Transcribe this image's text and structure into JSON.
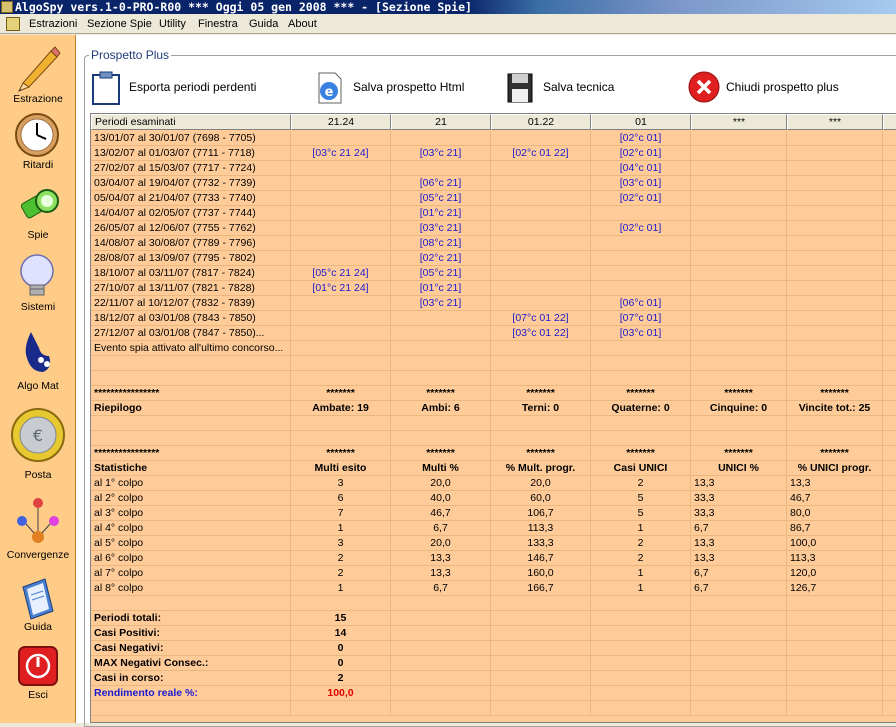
{
  "window": {
    "title": "AlgoSpy vers.1-0-PRO-R00  ***  Oggi 05 gen 2008  ***   - [Sezione Spie]"
  },
  "menu": [
    "Estrazioni",
    "Sezione Spie",
    "Utility",
    "Finestra",
    "Guida",
    "About"
  ],
  "sidebar": [
    {
      "label": "Estrazione",
      "icon": "pencil-icon"
    },
    {
      "label": "Ritardi",
      "icon": "clock-icon"
    },
    {
      "label": "Spie",
      "icon": "flashlight-icon"
    },
    {
      "label": "Sistemi",
      "icon": "lightbulb-icon"
    },
    {
      "label": "Algo Mat",
      "icon": "lottery-hand-icon"
    },
    {
      "label": "Posta",
      "icon": "euro-coin-icon"
    },
    {
      "label": "Convergenze",
      "icon": "convergence-icon"
    },
    {
      "label": "Guida",
      "icon": "book-icon"
    },
    {
      "label": "Esci",
      "icon": "exit-icon"
    }
  ],
  "group_title": "Prospetto Plus",
  "toolbar": {
    "export_label": "Esporta periodi perdenti",
    "save_html_label": "Salva prospetto Html",
    "save_tech_label": "Salva tecnica",
    "close_label": "Chiudi prospetto plus"
  },
  "colors": {
    "grid_bg": "#ffcc99",
    "sidebar_bg": "#ffcc88",
    "link_blue": "#1a1ad0",
    "accent_red": "#e00000"
  },
  "grid": {
    "headers": [
      "Periodi esaminati",
      "21.24",
      "21",
      "01.22",
      "01",
      "***",
      "***",
      ""
    ],
    "rows": [
      {
        "style": "normal",
        "cells": [
          "13/01/07 al 30/01/07  (7698 - 7705)",
          "",
          "",
          "",
          "[02°c 01]",
          "",
          "",
          ""
        ]
      },
      {
        "style": "normal",
        "cells": [
          "13/02/07 al 01/03/07  (7711 - 7718)",
          "[03°c 21 24]",
          "[03°c 21]",
          "[02°c 01 22]",
          "[02°c 01]",
          "",
          "",
          ""
        ]
      },
      {
        "style": "normal",
        "cells": [
          "27/02/07 al 15/03/07  (7717 - 7724)",
          "",
          "",
          "",
          "[04°c 01]",
          "",
          "",
          ""
        ]
      },
      {
        "style": "normal",
        "cells": [
          "03/04/07 al 19/04/07  (7732 - 7739)",
          "",
          "[06°c 21]",
          "",
          "[03°c 01]",
          "",
          "",
          ""
        ]
      },
      {
        "style": "normal",
        "cells": [
          "05/04/07 al 21/04/07  (7733 - 7740)",
          "",
          "[05°c 21]",
          "",
          "[02°c 01]",
          "",
          "",
          ""
        ]
      },
      {
        "style": "normal",
        "cells": [
          "14/04/07 al 02/05/07  (7737 - 7744)",
          "",
          "[01°c 21]",
          "",
          "",
          "",
          "",
          ""
        ]
      },
      {
        "style": "normal",
        "cells": [
          "26/05/07 al 12/06/07  (7755 - 7762)",
          "",
          "[03°c 21]",
          "",
          "[02°c 01]",
          "",
          "",
          ""
        ]
      },
      {
        "style": "normal",
        "cells": [
          "14/08/07 al 30/08/07  (7789 - 7796)",
          "",
          "[08°c 21]",
          "",
          "",
          "",
          "",
          ""
        ]
      },
      {
        "style": "normal",
        "cells": [
          "28/08/07 al 13/09/07  (7795 - 7802)",
          "",
          "[02°c 21]",
          "",
          "",
          "",
          "",
          ""
        ]
      },
      {
        "style": "normal",
        "cells": [
          "18/10/07 al 03/11/07  (7817 - 7824)",
          "[05°c 21 24]",
          "[05°c 21]",
          "",
          "",
          "",
          "",
          ""
        ]
      },
      {
        "style": "normal",
        "cells": [
          "27/10/07 al 13/11/07  (7821 - 7828)",
          "[01°c 21 24]",
          "[01°c 21]",
          "",
          "",
          "",
          "",
          ""
        ]
      },
      {
        "style": "normal",
        "cells": [
          "22/11/07 al 10/12/07  (7832 - 7839)",
          "",
          "[03°c 21]",
          "",
          "[06°c 01]",
          "",
          "",
          ""
        ]
      },
      {
        "style": "normal",
        "cells": [
          "18/12/07 al 03/01/08  (7843 - 7850)",
          "",
          "",
          "[07°c 01 22]",
          "[07°c 01]",
          "",
          "",
          ""
        ]
      },
      {
        "style": "normal",
        "cells": [
          "27/12/07 al 03/01/08  (7847 - 7850)...",
          "",
          "",
          "[03°c 01 22]",
          "[03°c 01]",
          "",
          "",
          ""
        ]
      },
      {
        "style": "normal",
        "cells": [
          "Evento spia attivato all'ultimo concorso...",
          "",
          "",
          "",
          "",
          "",
          "",
          ""
        ]
      },
      {
        "style": "normal",
        "cells": [
          "",
          "",
          "",
          "",
          "",
          "",
          "",
          ""
        ]
      },
      {
        "style": "normal",
        "cells": [
          "",
          "",
          "",
          "",
          "",
          "",
          "",
          ""
        ]
      },
      {
        "style": "stars",
        "cells": [
          "****************",
          "*******",
          "*******",
          "*******",
          "*******",
          "*******",
          "*******",
          ""
        ]
      },
      {
        "style": "bold",
        "cells": [
          "Riepilogo",
          "Ambate: 19",
          "Ambi: 6",
          "Terni: 0",
          "Quaterne: 0",
          "Cinquine: 0",
          "Vincite tot.: 25",
          ""
        ]
      },
      {
        "style": "normal",
        "cells": [
          "",
          "",
          "",
          "",
          "",
          "",
          "",
          ""
        ]
      },
      {
        "style": "normal",
        "cells": [
          "",
          "",
          "",
          "",
          "",
          "",
          "",
          ""
        ]
      },
      {
        "style": "stars",
        "cells": [
          "****************",
          "*******",
          "*******",
          "*******",
          "*******",
          "*******",
          "*******",
          ""
        ]
      },
      {
        "style": "bold",
        "cells": [
          "Statistiche",
          "Multi esito",
          "Multi %",
          "% Mult. progr.",
          "Casi UNICI",
          "UNICI %",
          "% UNICI progr.",
          ""
        ]
      },
      {
        "style": "stat",
        "cells": [
          "al 1° colpo",
          "3",
          "20,0",
          "20,0",
          "2",
          "13,3",
          "13,3",
          ""
        ]
      },
      {
        "style": "stat",
        "cells": [
          "al 2° colpo",
          "6",
          "40,0",
          "60,0",
          "5",
          "33,3",
          "46,7",
          ""
        ]
      },
      {
        "style": "stat",
        "cells": [
          "al 3° colpo",
          "7",
          "46,7",
          "106,7",
          "5",
          "33,3",
          "80,0",
          ""
        ]
      },
      {
        "style": "stat",
        "cells": [
          "al 4° colpo",
          "1",
          "6,7",
          "113,3",
          "1",
          "6,7",
          "86,7",
          ""
        ]
      },
      {
        "style": "stat",
        "cells": [
          "al 5° colpo",
          "3",
          "20,0",
          "133,3",
          "2",
          "13,3",
          "100,0",
          ""
        ]
      },
      {
        "style": "stat",
        "cells": [
          "al 6° colpo",
          "2",
          "13,3",
          "146,7",
          "2",
          "13,3",
          "113,3",
          ""
        ]
      },
      {
        "style": "stat",
        "cells": [
          "al 7° colpo",
          "2",
          "13,3",
          "160,0",
          "1",
          "6,7",
          "120,0",
          ""
        ]
      },
      {
        "style": "stat",
        "cells": [
          "al 8° colpo",
          "1",
          "6,7",
          "166,7",
          "1",
          "6,7",
          "126,7",
          ""
        ]
      },
      {
        "style": "normal",
        "cells": [
          "",
          "",
          "",
          "",
          "",
          "",
          "",
          ""
        ]
      },
      {
        "style": "bold",
        "cells": [
          "Periodi totali:",
          "15",
          "",
          "",
          "",
          "",
          "",
          ""
        ]
      },
      {
        "style": "bold",
        "cells": [
          "Casi Positivi:",
          "14",
          "",
          "",
          "",
          "",
          "",
          ""
        ]
      },
      {
        "style": "bold",
        "cells": [
          "Casi Negativi:",
          "0",
          "",
          "",
          "",
          "",
          "",
          ""
        ]
      },
      {
        "style": "bold",
        "cells": [
          "MAX Negativi Consec.:",
          "0",
          "",
          "",
          "",
          "",
          "",
          ""
        ]
      },
      {
        "style": "bold",
        "cells": [
          "Casi in corso:",
          "2",
          "",
          "",
          "",
          "",
          "",
          ""
        ]
      },
      {
        "style": "rend",
        "cells": [
          "Rendimento reale %:",
          "100,0",
          "",
          "",
          "",
          "",
          "",
          ""
        ]
      },
      {
        "style": "normal",
        "cells": [
          "",
          "",
          "",
          "",
          "",
          "",
          "",
          ""
        ]
      }
    ]
  }
}
